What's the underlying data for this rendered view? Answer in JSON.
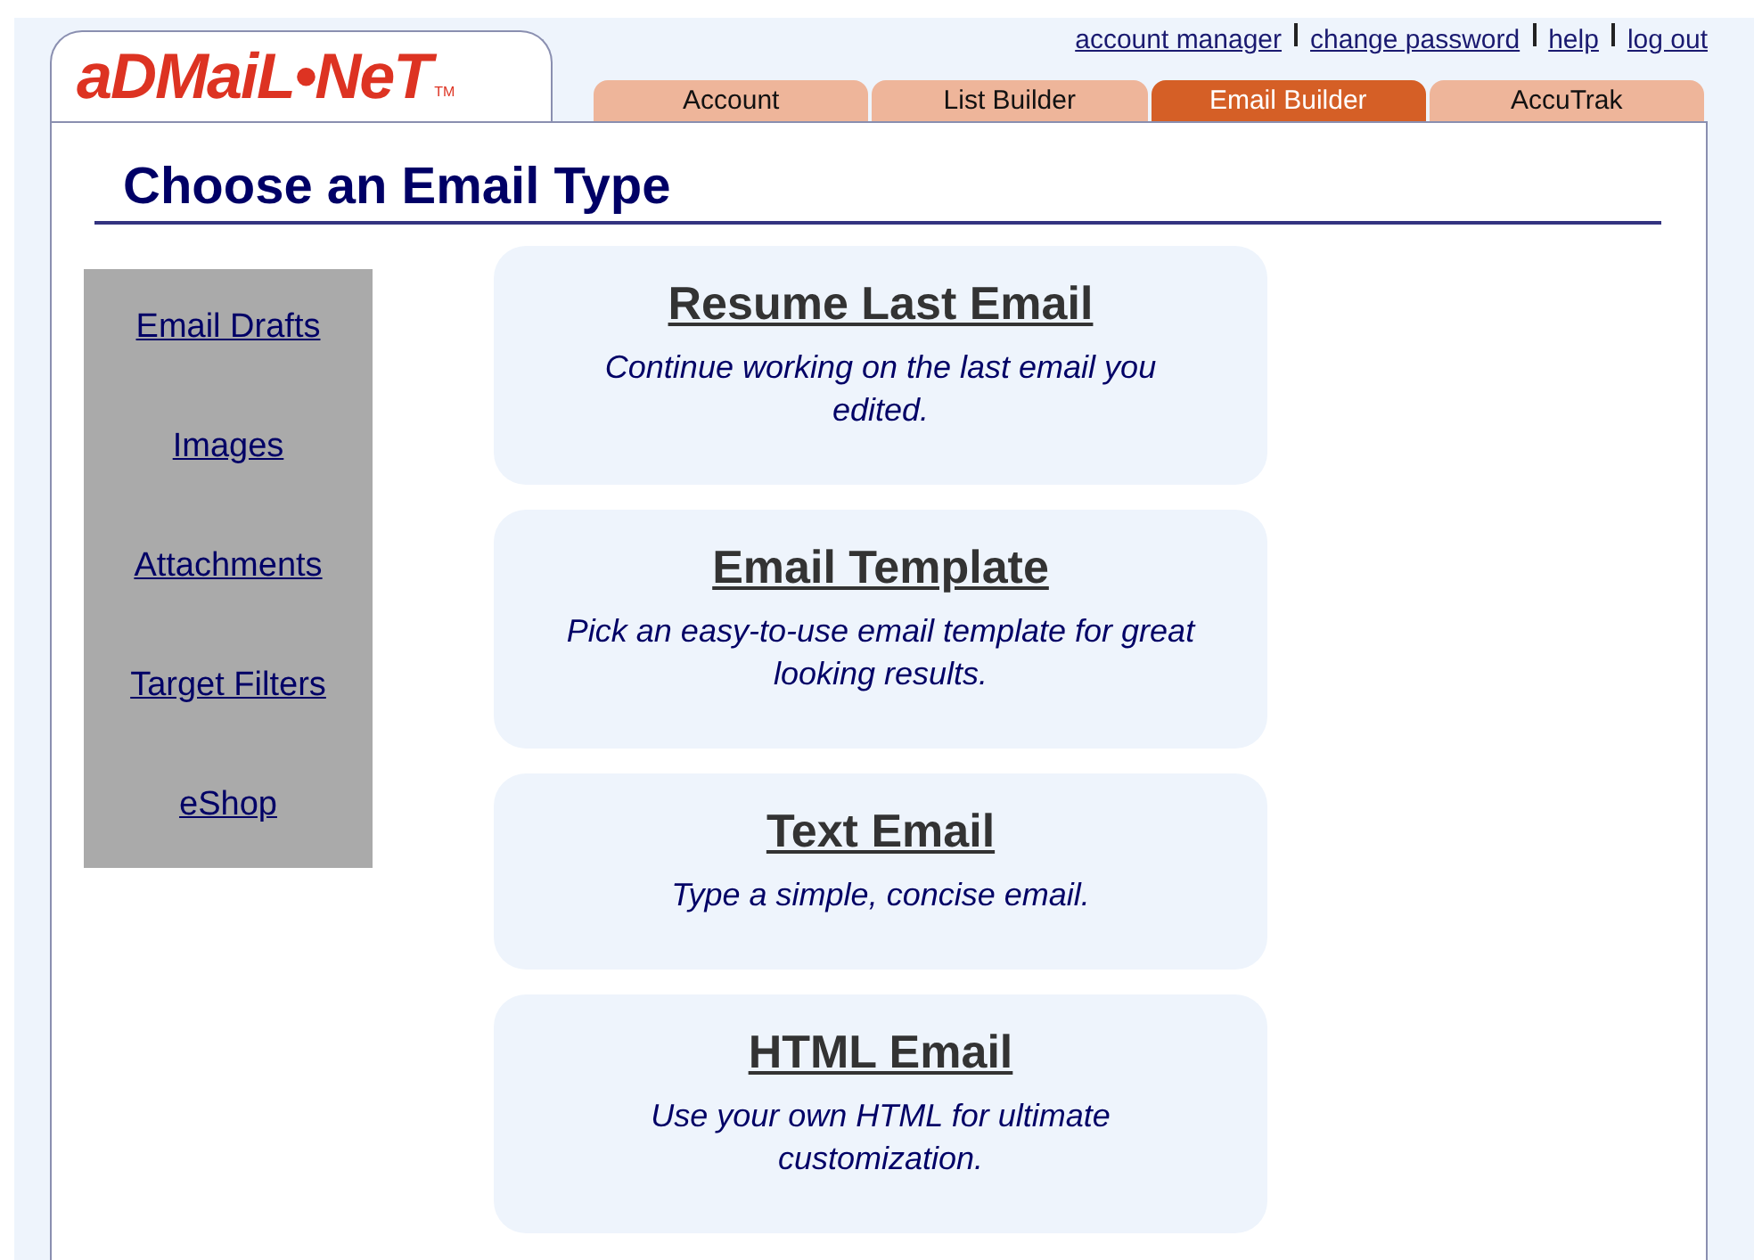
{
  "logo": {
    "text": "aDMaiL•NeT",
    "mark": "TM"
  },
  "top_links": [
    "account manager",
    "change password",
    "help",
    "log out"
  ],
  "tabs": [
    {
      "label": "Account",
      "selected": false
    },
    {
      "label": "List Builder",
      "selected": false
    },
    {
      "label": "Email Builder",
      "selected": true
    },
    {
      "label": "AccuTrak",
      "selected": false
    }
  ],
  "heading": "Choose an Email Type",
  "sidebar": {
    "items": [
      "Email Drafts",
      "Images",
      "Attachments",
      "Target Filters",
      "eShop"
    ]
  },
  "options": [
    {
      "title": "Resume Last Email",
      "description": "Continue working on the last email you edited."
    },
    {
      "title": "Email Template",
      "description": "Pick an easy-to-use email template for great looking results."
    },
    {
      "title": "Text Email",
      "description": "Type a simple, concise email."
    },
    {
      "title": "HTML Email",
      "description": "Use your own HTML for ultimate customization."
    }
  ]
}
